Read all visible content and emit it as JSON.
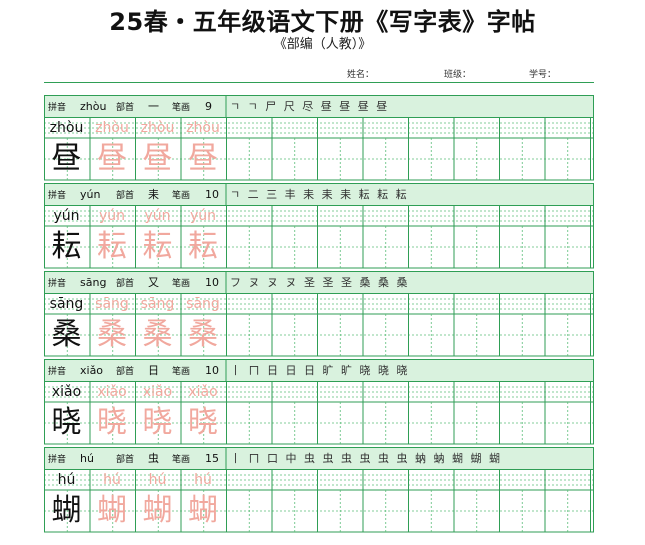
{
  "header": {
    "title": "25春・五年级语文下册《写字表》字帖",
    "subtitle": "《部编（人教）》",
    "name_label": "姓名：",
    "class_label": "班级：",
    "student_no_label": "学号："
  },
  "labels": {
    "pinyin": "拼音",
    "radical": "部首",
    "strokes": "笔画"
  },
  "rows": [
    {
      "pinyin": "zhòu",
      "radical": "一",
      "stroke_count": "9",
      "char": "昼",
      "stroke_order": "ㄱ ㄱ 尸 尺 尽 昼 昼 昼 昼"
    },
    {
      "pinyin": "yún",
      "radical": "耒",
      "stroke_count": "10",
      "char": "耘",
      "stroke_order": "ㄱ 二 三 丰 耒 耒 耒 耘 耘 耘"
    },
    {
      "pinyin": "sāng",
      "radical": "又",
      "stroke_count": "10",
      "char": "桑",
      "stroke_order": "フ ヌ ヌ ヌ 圣 圣 圣 桑 桑 桑"
    },
    {
      "pinyin": "xiǎo",
      "radical": "日",
      "stroke_count": "10",
      "char": "晓",
      "stroke_order": "丨 ㄇ 日 日 日 旷 旷 晓 晓 晓"
    },
    {
      "pinyin": "hú",
      "radical": "虫",
      "stroke_count": "15",
      "char": "蝴",
      "stroke_order": "丨 ㄇ 口 中 虫 虫 虫 虫 虫 虫 蚋 蚋 蝴 蝴 蝴"
    }
  ]
}
